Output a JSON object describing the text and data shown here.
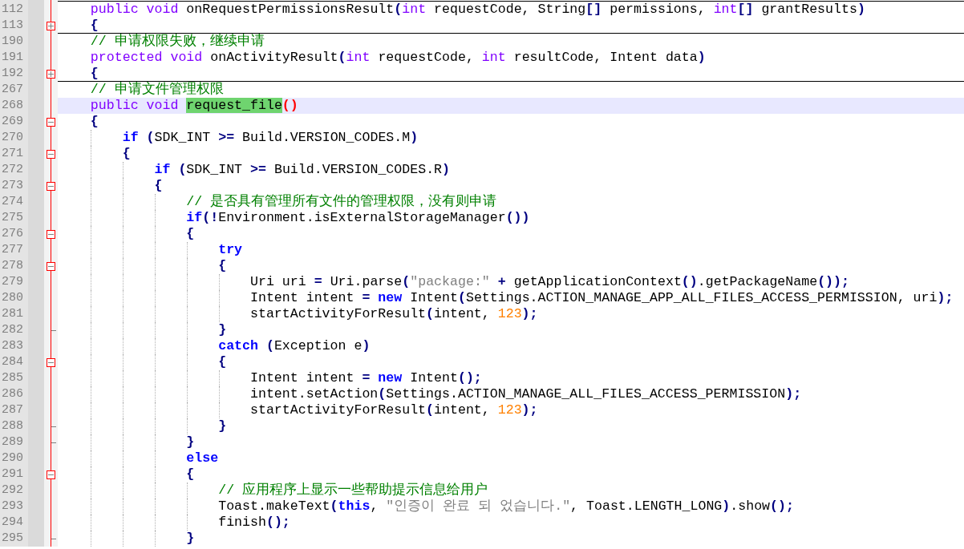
{
  "editor": {
    "lines": [
      {
        "number": "112",
        "kind": "text",
        "highlighted": false,
        "tokens": [
          {
            "kind": "type",
            "text": "    public void "
          },
          {
            "kind": "plain",
            "text": "onRequestPermissionsResult"
          },
          {
            "kind": "operator",
            "text": "("
          },
          {
            "kind": "type",
            "text": "int "
          },
          {
            "kind": "plain",
            "text": "requestCode, String"
          },
          {
            "kind": "operator",
            "text": "[]"
          },
          {
            "kind": "plain",
            "text": " permissions, "
          },
          {
            "kind": "type",
            "text": "int"
          },
          {
            "kind": "operator",
            "text": "[]"
          },
          {
            "kind": "plain",
            "text": " grantResults"
          },
          {
            "kind": "operator",
            "text": ")"
          }
        ]
      },
      {
        "number": "113",
        "kind": "collapsed",
        "highlighted": false,
        "tokens": [
          {
            "kind": "operator",
            "text": "    {"
          }
        ]
      },
      {
        "number": "190",
        "kind": "text",
        "highlighted": false,
        "tokens": [
          {
            "kind": "comment",
            "text": "    // 申请权限失败，继续申请"
          }
        ]
      },
      {
        "number": "191",
        "kind": "text",
        "highlighted": false,
        "tokens": [
          {
            "kind": "type",
            "text": "    protected void "
          },
          {
            "kind": "plain",
            "text": "onActivityResult"
          },
          {
            "kind": "operator",
            "text": "("
          },
          {
            "kind": "type",
            "text": "int "
          },
          {
            "kind": "plain",
            "text": "requestCode, "
          },
          {
            "kind": "type",
            "text": "int "
          },
          {
            "kind": "plain",
            "text": "resultCode, Intent data"
          },
          {
            "kind": "operator",
            "text": ")"
          }
        ]
      },
      {
        "number": "192",
        "kind": "collapsed",
        "highlighted": false,
        "tokens": [
          {
            "kind": "operator",
            "text": "    {"
          }
        ]
      },
      {
        "number": "267",
        "kind": "text",
        "highlighted": false,
        "tokens": [
          {
            "kind": "comment",
            "text": "    // 申请文件管理权限"
          }
        ]
      },
      {
        "number": "268",
        "kind": "text",
        "highlighted": true,
        "tokens": [
          {
            "kind": "type",
            "text": "    public void "
          },
          {
            "kind": "match",
            "text": "request_file"
          },
          {
            "kind": "brace",
            "text": "()"
          }
        ]
      },
      {
        "number": "269",
        "kind": "expanded",
        "highlighted": false,
        "tokens": [
          {
            "kind": "operator",
            "text": "    {"
          }
        ]
      },
      {
        "number": "270",
        "kind": "text",
        "highlighted": false,
        "tokens": [
          {
            "kind": "keyword",
            "text": "        if "
          },
          {
            "kind": "operator",
            "text": "("
          },
          {
            "kind": "plain",
            "text": "SDK_INT "
          },
          {
            "kind": "operator",
            "text": ">="
          },
          {
            "kind": "plain",
            "text": " Build.VERSION_CODES.M"
          },
          {
            "kind": "operator",
            "text": ")"
          }
        ]
      },
      {
        "number": "271",
        "kind": "expanded",
        "highlighted": false,
        "tokens": [
          {
            "kind": "operator",
            "text": "        {"
          }
        ]
      },
      {
        "number": "272",
        "kind": "text",
        "highlighted": false,
        "tokens": [
          {
            "kind": "keyword",
            "text": "            if "
          },
          {
            "kind": "operator",
            "text": "("
          },
          {
            "kind": "plain",
            "text": "SDK_INT "
          },
          {
            "kind": "operator",
            "text": ">="
          },
          {
            "kind": "plain",
            "text": " Build.VERSION_CODES.R"
          },
          {
            "kind": "operator",
            "text": ")"
          }
        ]
      },
      {
        "number": "273",
        "kind": "expanded",
        "highlighted": false,
        "tokens": [
          {
            "kind": "operator",
            "text": "            {"
          }
        ]
      },
      {
        "number": "274",
        "kind": "text",
        "highlighted": false,
        "tokens": [
          {
            "kind": "comment",
            "text": "                // 是否具有管理所有文件的管理权限，没有则申请"
          }
        ]
      },
      {
        "number": "275",
        "kind": "text",
        "highlighted": false,
        "tokens": [
          {
            "kind": "keyword",
            "text": "                if"
          },
          {
            "kind": "operator",
            "text": "(!"
          },
          {
            "kind": "plain",
            "text": "Environment.isExternalStorageManager"
          },
          {
            "kind": "operator",
            "text": "())"
          }
        ]
      },
      {
        "number": "276",
        "kind": "expanded",
        "highlighted": false,
        "tokens": [
          {
            "kind": "operator",
            "text": "                {"
          }
        ]
      },
      {
        "number": "277",
        "kind": "text",
        "highlighted": false,
        "tokens": [
          {
            "kind": "keyword",
            "text": "                    try"
          }
        ]
      },
      {
        "number": "278",
        "kind": "expanded",
        "highlighted": false,
        "tokens": [
          {
            "kind": "operator",
            "text": "                    {"
          }
        ]
      },
      {
        "number": "279",
        "kind": "text",
        "highlighted": false,
        "tokens": [
          {
            "kind": "plain",
            "text": "                        Uri uri "
          },
          {
            "kind": "operator",
            "text": "="
          },
          {
            "kind": "plain",
            "text": " Uri.parse"
          },
          {
            "kind": "operator",
            "text": "("
          },
          {
            "kind": "string",
            "text": "\"package:\" "
          },
          {
            "kind": "operator",
            "text": "+"
          },
          {
            "kind": "plain",
            "text": " getApplicationContext"
          },
          {
            "kind": "operator",
            "text": "()"
          },
          {
            "kind": "plain",
            "text": ".getPackageName"
          },
          {
            "kind": "operator",
            "text": "());"
          }
        ]
      },
      {
        "number": "280",
        "kind": "text",
        "highlighted": false,
        "tokens": [
          {
            "kind": "plain",
            "text": "                        Intent intent "
          },
          {
            "kind": "operator",
            "text": "= "
          },
          {
            "kind": "keyword",
            "text": "new "
          },
          {
            "kind": "plain",
            "text": "Intent"
          },
          {
            "kind": "operator",
            "text": "("
          },
          {
            "kind": "plain",
            "text": "Settings.ACTION_MANAGE_APP_ALL_FILES_ACCESS_PERMISSION, uri"
          },
          {
            "kind": "operator",
            "text": ");"
          }
        ]
      },
      {
        "number": "281",
        "kind": "text",
        "highlighted": false,
        "tokens": [
          {
            "kind": "plain",
            "text": "                        startActivityForResult"
          },
          {
            "kind": "operator",
            "text": "("
          },
          {
            "kind": "plain",
            "text": "intent, "
          },
          {
            "kind": "number",
            "text": "123"
          },
          {
            "kind": "operator",
            "text": ");"
          }
        ]
      },
      {
        "number": "282",
        "kind": "end",
        "highlighted": false,
        "tokens": [
          {
            "kind": "operator",
            "text": "                    }"
          }
        ]
      },
      {
        "number": "283",
        "kind": "text",
        "highlighted": false,
        "tokens": [
          {
            "kind": "keyword",
            "text": "                    catch "
          },
          {
            "kind": "operator",
            "text": "("
          },
          {
            "kind": "plain",
            "text": "Exception e"
          },
          {
            "kind": "operator",
            "text": ")"
          }
        ]
      },
      {
        "number": "284",
        "kind": "expanded",
        "highlighted": false,
        "tokens": [
          {
            "kind": "operator",
            "text": "                    {"
          }
        ]
      },
      {
        "number": "285",
        "kind": "text",
        "highlighted": false,
        "tokens": [
          {
            "kind": "plain",
            "text": "                        Intent intent "
          },
          {
            "kind": "operator",
            "text": "= "
          },
          {
            "kind": "keyword",
            "text": "new "
          },
          {
            "kind": "plain",
            "text": "Intent"
          },
          {
            "kind": "operator",
            "text": "();"
          }
        ]
      },
      {
        "number": "286",
        "kind": "text",
        "highlighted": false,
        "tokens": [
          {
            "kind": "plain",
            "text": "                        intent.setAction"
          },
          {
            "kind": "operator",
            "text": "("
          },
          {
            "kind": "plain",
            "text": "Settings.ACTION_MANAGE_ALL_FILES_ACCESS_PERMISSION"
          },
          {
            "kind": "operator",
            "text": ");"
          }
        ]
      },
      {
        "number": "287",
        "kind": "text",
        "highlighted": false,
        "tokens": [
          {
            "kind": "plain",
            "text": "                        startActivityForResult"
          },
          {
            "kind": "operator",
            "text": "("
          },
          {
            "kind": "plain",
            "text": "intent, "
          },
          {
            "kind": "number",
            "text": "123"
          },
          {
            "kind": "operator",
            "text": ");"
          }
        ]
      },
      {
        "number": "288",
        "kind": "end",
        "highlighted": false,
        "tokens": [
          {
            "kind": "operator",
            "text": "                    }"
          }
        ]
      },
      {
        "number": "289",
        "kind": "end",
        "highlighted": false,
        "tokens": [
          {
            "kind": "operator",
            "text": "                }"
          }
        ]
      },
      {
        "number": "290",
        "kind": "text",
        "highlighted": false,
        "tokens": [
          {
            "kind": "keyword",
            "text": "                else"
          }
        ]
      },
      {
        "number": "291",
        "kind": "expanded",
        "highlighted": false,
        "tokens": [
          {
            "kind": "operator",
            "text": "                {"
          }
        ]
      },
      {
        "number": "292",
        "kind": "text",
        "highlighted": false,
        "tokens": [
          {
            "kind": "comment",
            "text": "                    // 应用程序上显示一些帮助提示信息给用户"
          }
        ]
      },
      {
        "number": "293",
        "kind": "text",
        "highlighted": false,
        "tokens": [
          {
            "kind": "plain",
            "text": "                    Toast.makeText"
          },
          {
            "kind": "operator",
            "text": "("
          },
          {
            "kind": "keyword",
            "text": "this"
          },
          {
            "kind": "plain",
            "text": ", "
          },
          {
            "kind": "string",
            "text": "\"인증이 완료 되 었습니다.\""
          },
          {
            "kind": "plain",
            "text": ", Toast.LENGTH_LONG"
          },
          {
            "kind": "operator",
            "text": ")"
          },
          {
            "kind": "plain",
            "text": ".show"
          },
          {
            "kind": "operator",
            "text": "();"
          }
        ]
      },
      {
        "number": "294",
        "kind": "text",
        "highlighted": false,
        "tokens": [
          {
            "kind": "plain",
            "text": "                    finish"
          },
          {
            "kind": "operator",
            "text": "();"
          }
        ]
      },
      {
        "number": "295",
        "kind": "end",
        "highlighted": false,
        "tokens": [
          {
            "kind": "operator",
            "text": "                }"
          }
        ]
      }
    ]
  }
}
